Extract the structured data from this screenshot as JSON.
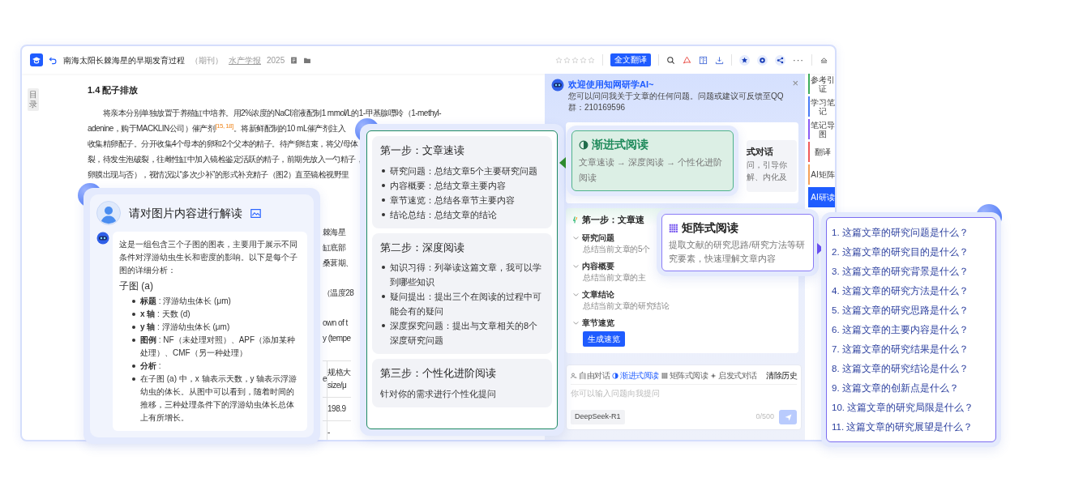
{
  "toolbar": {
    "title": "南海太阳长棘海星的早期发育过程",
    "type_label": "（期刊）",
    "journal": "水产学报",
    "year": "2025",
    "stars": 0,
    "translate_button": "全文翻译",
    "more_button": "···"
  },
  "toc_tab": "目录",
  "article": {
    "heading": "1.4 配子排放",
    "lines": [
      "将亲本分别单独放置于养殖缸中培养。用2%浓度的NaCl溶液配制1 mmol/L的1-甲基腺嘌呤（1-methyl-",
      "adenine，购于MACKLIN公司）催产剂$^{[15, 18]}$。将新鲜配制的10 mL催产剂注入",
      "收集精卵配子。分开收集4个母本的卵和2个父本的精子。待产卵结束，将父/母体",
      "裂，待发生泡破裂，往雌性缸中加入镜检鉴定活跃的精子，前期先放入一勺精子，",
      "卵膜出现与否），视情况以“多次少补”的形式补充精子（图2）直至镜检视野里"
    ],
    "peek_lines": [
      [
        "棘海星",
        "缸底部",
        "桑葚期、"
      ],
      [
        "（温度28"
      ],
      [
        "own of t",
        "y (tempe"
      ]
    ],
    "peek_table": {
      "header": [
        "e",
        [
          "规格大",
          "size/μ"
        ]
      ],
      "rows": [
        "198.9",
        "-"
      ]
    }
  },
  "ai_panel": {
    "welcome_title": "欢迎使用知网研学AI~",
    "welcome_text": "您可以问问我关于文章的任何问题。问题或建议可反馈至QQ群：210169596",
    "close": "×",
    "intro_fragment": {
      "title": "式对话",
      "lines": [
        "问，引导你",
        "解、内化及"
      ]
    },
    "steps_card": {
      "title": "第一步：文章速",
      "sections": [
        {
          "title": "研究问题",
          "desc": "总结当前文章的5个"
        },
        {
          "title": "内容概要",
          "desc": "总结当前文章的主"
        },
        {
          "title": "文章结论",
          "desc": "总结当前文章的研究结论"
        },
        {
          "title": "章节速览",
          "button": "生成速览"
        }
      ]
    },
    "composer": {
      "modes": [
        {
          "kind": "chat",
          "label": "自由对话",
          "selected": false
        },
        {
          "kind": "progressive",
          "label": "渐进式阅读",
          "selected": true
        },
        {
          "kind": "matrix",
          "label": "矩阵式阅读",
          "selected": false
        },
        {
          "kind": "spark",
          "label": "启发式对话",
          "selected": false
        }
      ],
      "clear_button": "清除历史",
      "placeholder": "你可以输入问题向我提问",
      "model": "DeepSeek-R1",
      "counter": "0/500",
      "send_disabled": true
    }
  },
  "sidebar_tabs": [
    {
      "label": "参考引证",
      "color": "#3fae5c",
      "selected": false
    },
    {
      "label": "学习笔记",
      "color": "#4a7cf7",
      "selected": false
    },
    {
      "label": "笔记导图",
      "color": "#8a5cf6",
      "selected": false
    },
    {
      "label": "翻译",
      "color": "#f05b5b",
      "selected": false
    },
    {
      "label": "AI矩阵",
      "color": "#f5a05a",
      "selected": false
    },
    {
      "label": "AI研读",
      "color": "#1f5cff",
      "selected": true
    }
  ],
  "image_card": {
    "question": "请对图片内容进行解读",
    "intro": "这是一组包含三个子图的图表，主要用于展示不同条件对浮游幼虫生长和密度的影响。以下是每个子图的详细分析：",
    "subheading": "子图 (a)",
    "items": [
      "**标题** : 浮游幼虫体长 (μm)",
      "**x 轴** : 天数 (d)",
      "**y 轴** : 浮游幼虫体长 (μm)",
      "**图例** : NF（未处理对照）、APF（添加某种处理）、CMF（另一种处理）",
      "**分析** :",
      "在子图 (a) 中，x 轴表示天数，y 轴表示浮游幼虫的体长。从图中可以看到，随着时间的推移，三种处理条件下的浮游幼虫体长总体上有所增长。"
    ]
  },
  "reading_steps": [
    {
      "title": "第一步：文章速读",
      "items": [
        "研究问题：总结文章5个主要研究问题",
        "内容概要：总结文章主要内容",
        "章节速览：总结各章节主要内容",
        "结论总结：总结文章的结论"
      ]
    },
    {
      "title": "第二步：深度阅读",
      "items": [
        "知识习得：列举读这篇文章，我可以学到哪些知识",
        "疑问提出：提出三个在阅读的过程中可能会有的疑问",
        "深度探究问题：提出与文章相关的8个深度研究问题"
      ]
    },
    {
      "title": "第三步：个性化进阶阅读",
      "text": "针对你的需求进行个性化提问"
    }
  ],
  "progressive_card": {
    "title": "渐进式阅读",
    "text": "文章速读 → 深度阅读 → 个性化进阶阅读"
  },
  "matrix_card": {
    "title": "矩阵式阅读",
    "text": "提取文献的研究思路/研究方法等研究要素，快速理解文章内容"
  },
  "questions": [
    "1. 这篇文章的研究问题是什么？",
    "2. 这篇文章的研究目的是什么？",
    "3. 这篇文章的研究背景是什么？",
    "4. 这篇文章的研究方法是什么？",
    "5. 这篇文章的研究思路是什么？",
    "6. 这篇文章的主要内容是什么？",
    "7. 这篇文章的研究结果是什么？",
    "8. 这篇文章的研究结论是什么？",
    "9. 这篇文章的创新点是什么？",
    "10. 这篇文章的研究局限是什么？",
    "11. 这篇文章的研究展望是什么？"
  ]
}
